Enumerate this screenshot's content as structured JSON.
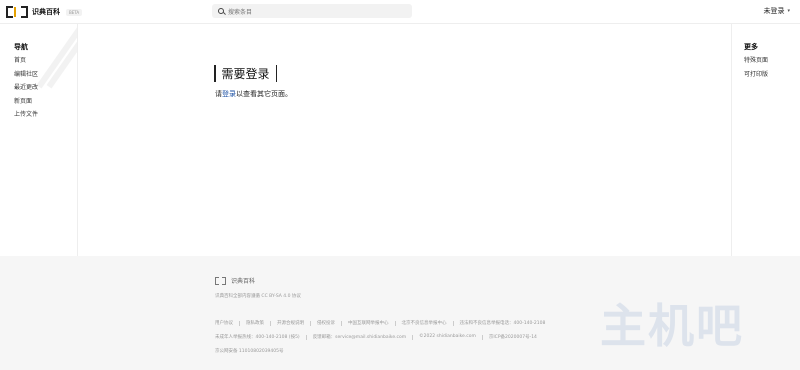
{
  "header": {
    "logo_text": "识典百科",
    "beta": "BETA",
    "search_placeholder": "搜索条目",
    "login_label": "未登录"
  },
  "sidebar_left": {
    "title": "导航",
    "items": [
      "首页",
      "编辑社区",
      "最近更改",
      "新页面",
      "上传文件"
    ]
  },
  "sidebar_right": {
    "title": "更多",
    "items": [
      "特殊页面",
      "可打印版"
    ]
  },
  "main": {
    "title": "需要登录",
    "msg_prefix": "请",
    "msg_link": "登录",
    "msg_suffix": "以查看其它页面。"
  },
  "footer": {
    "logo_text": "识典百科",
    "license": "识典百科全部内容遵循 CC BY-SA 4.0 协议",
    "line1": [
      "用户协议",
      "隐私政策",
      "开源合规说明",
      "侵权投诉",
      "中国互联网举报中心",
      "北京不良信息举报中心",
      "违法和不良信息举报电话：400-140-2108"
    ],
    "line2": [
      "未成年人举报热线：400-140-2108 (按5)",
      "反馈邮箱：service@mail.shidianbaike.com",
      "©2022 shidianbaike.com",
      "京ICP备2020007号-14"
    ],
    "line3": "京公网安备 11010802039405号"
  },
  "watermark": "主机吧"
}
